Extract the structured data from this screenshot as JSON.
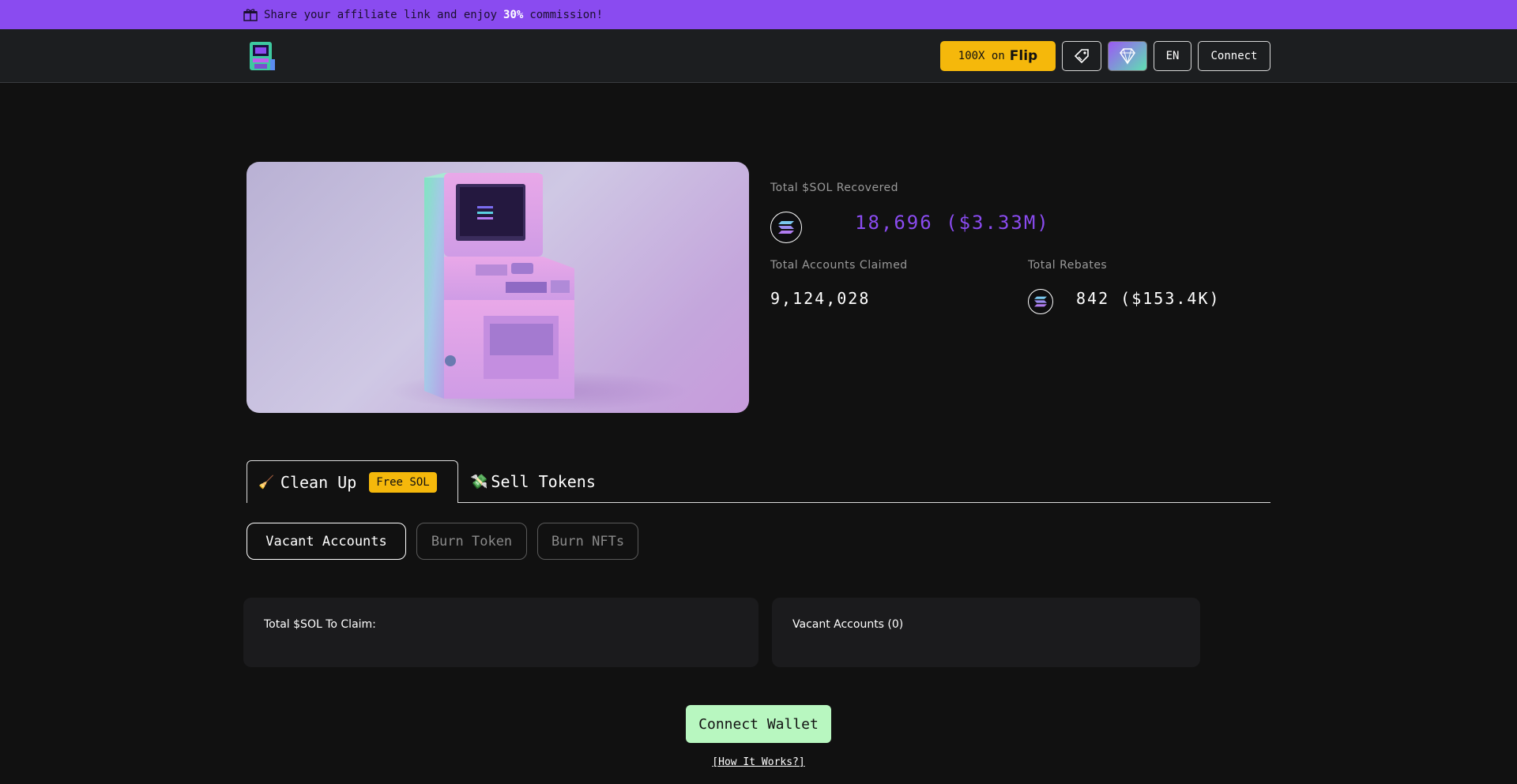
{
  "banner": {
    "text_before": "Share your affiliate link and enjoy",
    "highlight": "30%",
    "text_after": "commission!",
    "icon": "gift-icon"
  },
  "header": {
    "logo_icon": "arcade-machine-logo-icon",
    "flip_prefix": "100X on",
    "flip_name": "Flip",
    "tag_icon": "tag-icon",
    "gem_icon": "diamond-icon",
    "language": "EN",
    "connect": "Connect"
  },
  "stats": {
    "total_recovered_label": "Total $SOL Recovered",
    "total_recovered_value": "18,696 ($3.33M)",
    "accounts_claimed_label": "Total Accounts Claimed",
    "accounts_claimed_value": "9,124,028",
    "rebates_label": "Total Rebates",
    "rebates_value": "842 ($153.4K)"
  },
  "tabs": {
    "clean_up": "Clean Up",
    "clean_up_icon": "broom-icon",
    "free_badge": "Free SOL",
    "sell_tokens": "Sell Tokens",
    "sell_icon": "money-icon"
  },
  "subtabs": [
    "Vacant Accounts",
    "Burn Token",
    "Burn NFTs"
  ],
  "cards": {
    "claim_label": "Total $SOL To Claim:",
    "vacant_label": "Vacant Accounts (0)"
  },
  "actions": {
    "connect_wallet": "Connect Wallet",
    "how_it_works": "[How It Works?]"
  },
  "colors": {
    "banner": "#8a4bf0",
    "accent_purple": "#8a4bf0",
    "badge_yellow": "#f5b80b",
    "wallet_green": "#b8f7c0",
    "background": "#111111"
  }
}
